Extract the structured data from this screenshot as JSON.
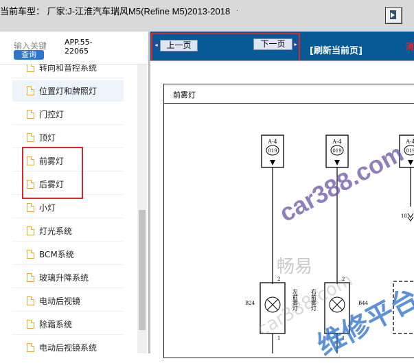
{
  "titlebar": {
    "title": "当前车型：  厂家:J-江淮汽车瑞风M5(Refine M5)2013-2018",
    "dot": ".",
    "exit_icon": "exit-door-icon"
  },
  "search": {
    "label": "输入关键",
    "button": "查询",
    "app_code_line1": "APP.55-",
    "app_code_line2": "22065"
  },
  "tree": {
    "items": [
      {
        "label": "转向和音控系统"
      },
      {
        "label": "位置灯和牌照灯"
      },
      {
        "label": "门控灯"
      },
      {
        "label": "顶灯"
      },
      {
        "label": "前雾灯"
      },
      {
        "label": "后雾灯"
      },
      {
        "label": "小灯"
      },
      {
        "label": "灯光系统"
      },
      {
        "label": "BCM系统"
      },
      {
        "label": "玻璃升降系统"
      },
      {
        "label": "电动后视镜"
      },
      {
        "label": "除霜系统"
      },
      {
        "label": "电动后视镜系统"
      }
    ],
    "selected": "位置灯和牌照灯",
    "scroll_position": 0.55
  },
  "nav": {
    "prev": "上一页",
    "next": "下一页",
    "refresh": "[刷新当前页]",
    "edge_text": "消"
  },
  "document": {
    "title": "前雾灯",
    "connectors": [
      {
        "code": "A-4",
        "pin": "019"
      },
      {
        "code": "A-4",
        "pin": "019"
      },
      {
        "code": "A-4",
        "pin": "019"
      }
    ],
    "wire_number": "18",
    "pin_top": "2",
    "pin_bottom": "1",
    "lamp_left_code": "B24",
    "lamp_right_code": "B44",
    "lamp_left_label": "左前雾灯",
    "lamp_right_label": "右前雾灯"
  },
  "watermarks": {
    "site": "car388.com",
    "brand": "畅易",
    "platform": "维修平台"
  },
  "colors": {
    "navbar": "#055a96",
    "highlight": "#d9262b",
    "accent_blue": "#2f76c9"
  }
}
